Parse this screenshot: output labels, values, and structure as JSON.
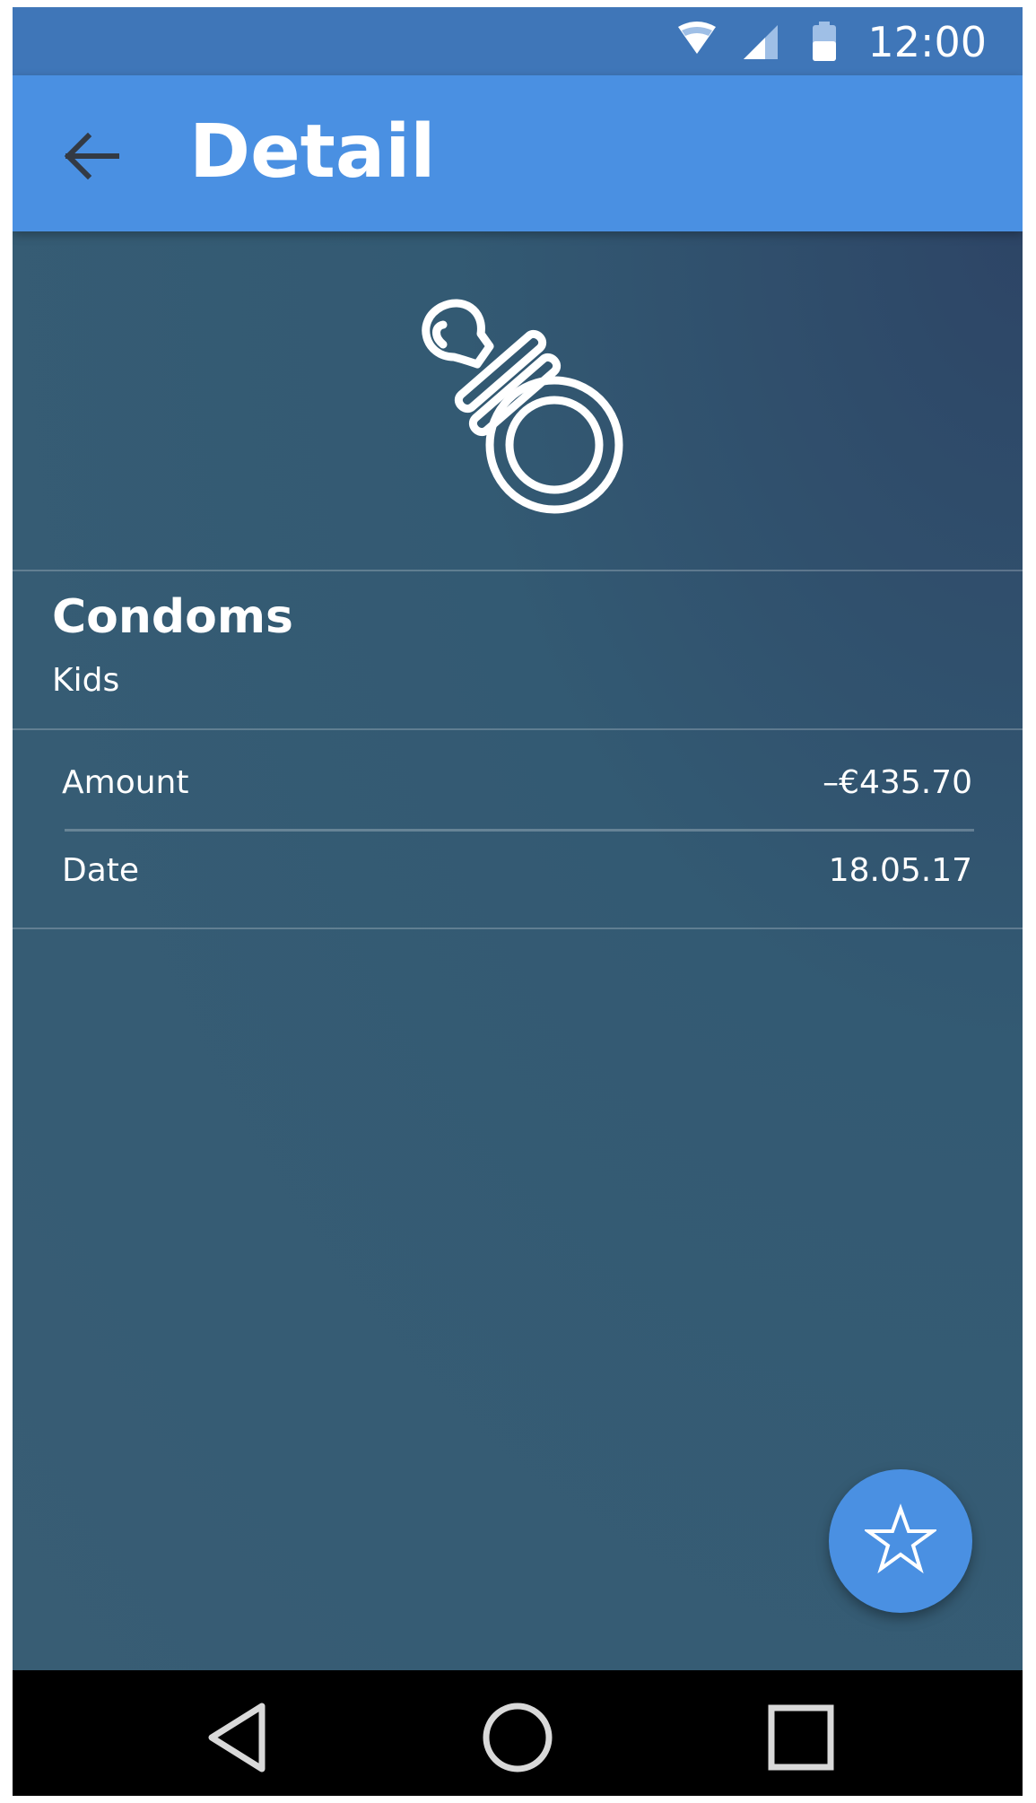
{
  "status_bar": {
    "time": "12:00",
    "icons": [
      "wifi-icon",
      "cell-signal-icon",
      "battery-icon"
    ]
  },
  "app_bar": {
    "back_icon": "arrow-back-icon",
    "title": "Detail",
    "color": "#4a90e2"
  },
  "hero": {
    "icon": "pacifier-icon"
  },
  "transaction": {
    "title": "Condoms",
    "category": "Kids",
    "rows": [
      {
        "label": "Amount",
        "value": "–€435.70"
      },
      {
        "label": "Date",
        "value": "18.05.17"
      }
    ]
  },
  "fab": {
    "icon": "star-outline-icon",
    "color": "#4a90e2"
  },
  "nav_bar": {
    "buttons": [
      "back-triangle-icon",
      "home-circle-icon",
      "recents-square-icon"
    ]
  }
}
